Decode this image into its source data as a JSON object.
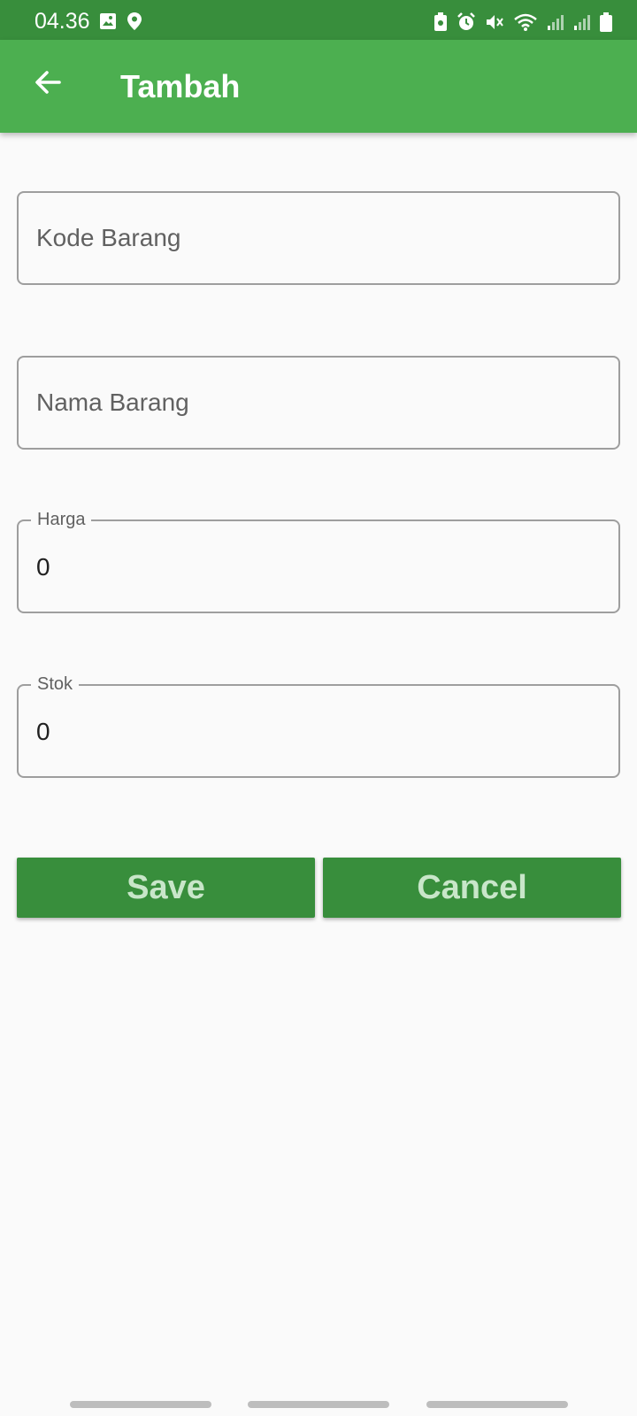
{
  "status_bar": {
    "time": "04.36",
    "icons": [
      "image-icon",
      "location-icon",
      "screenshot-icon",
      "alarm-icon",
      "mute-icon",
      "wifi-icon",
      "signal-icon",
      "signal-icon",
      "battery-icon"
    ]
  },
  "app_bar": {
    "title": "Tambah",
    "back_icon": "arrow-back-icon"
  },
  "form": {
    "kode_barang": {
      "placeholder": "Kode Barang",
      "value": ""
    },
    "nama_barang": {
      "placeholder": "Nama Barang",
      "value": ""
    },
    "harga": {
      "label": "Harga",
      "value": "0"
    },
    "stok": {
      "label": "Stok",
      "value": "0"
    }
  },
  "buttons": {
    "save_label": "Save",
    "cancel_label": "Cancel"
  },
  "colors": {
    "status_bar": "#388e3c",
    "app_bar": "#4caf50",
    "button_bg": "#388e3c",
    "button_text": "#c8e6c9",
    "background": "#fafafa"
  }
}
